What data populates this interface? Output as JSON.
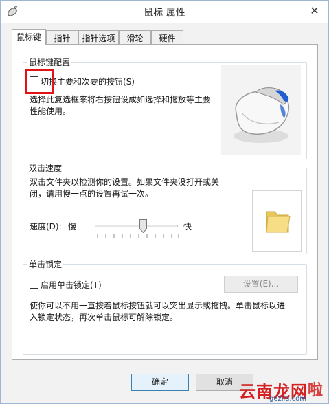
{
  "window": {
    "title": "鼠标 属性",
    "close_glyph": "✕"
  },
  "tabs": [
    {
      "label": "鼠标键",
      "active": true
    },
    {
      "label": "指针",
      "active": false
    },
    {
      "label": "指针选项",
      "active": false
    },
    {
      "label": "滑轮",
      "active": false
    },
    {
      "label": "硬件",
      "active": false
    }
  ],
  "button_config": {
    "group_title": "鼠标键配置",
    "swap_checkbox_label": "切换主要和次要的按钮(S)",
    "swap_checked": false,
    "description_line1": "选择此复选框来将右按钮设成如选择和拖放等主要",
    "description_line2": "性能使用。"
  },
  "double_click": {
    "group_title": "双击速度",
    "description_line1": "双击文件夹以检测你的设置。如果文件夹没打开或关",
    "description_line2": "闭，请用慢一点的设置再试一次。",
    "speed_label": "速度(D):",
    "slow_label": "慢",
    "fast_label": "快",
    "speed_level_percent": 58
  },
  "click_lock": {
    "group_title": "单击锁定",
    "checkbox_label": "启用单击锁定(T)",
    "checked": false,
    "settings_button": "设置(E)...",
    "description_line1": "使你可以不用一直按着鼠标按钮就可以突出显示或拖拽。单击鼠标以进",
    "description_line2": "入锁定状态，再次单击鼠标可解除锁定。"
  },
  "footer": {
    "ok_label": "确定",
    "cancel_label": "取消"
  },
  "watermark": {
    "main": "云南龙网",
    "tail": "啦",
    "url": "gezila.com"
  },
  "colors": {
    "highlight_box": "#e01414",
    "watermark_red": "#d42020",
    "mouse_accent": "#1f5fd1"
  },
  "icons": [
    "mouse-app-icon",
    "close-icon",
    "mouse-preview-icon",
    "folder-icon",
    "slider-thumb-icon"
  ]
}
